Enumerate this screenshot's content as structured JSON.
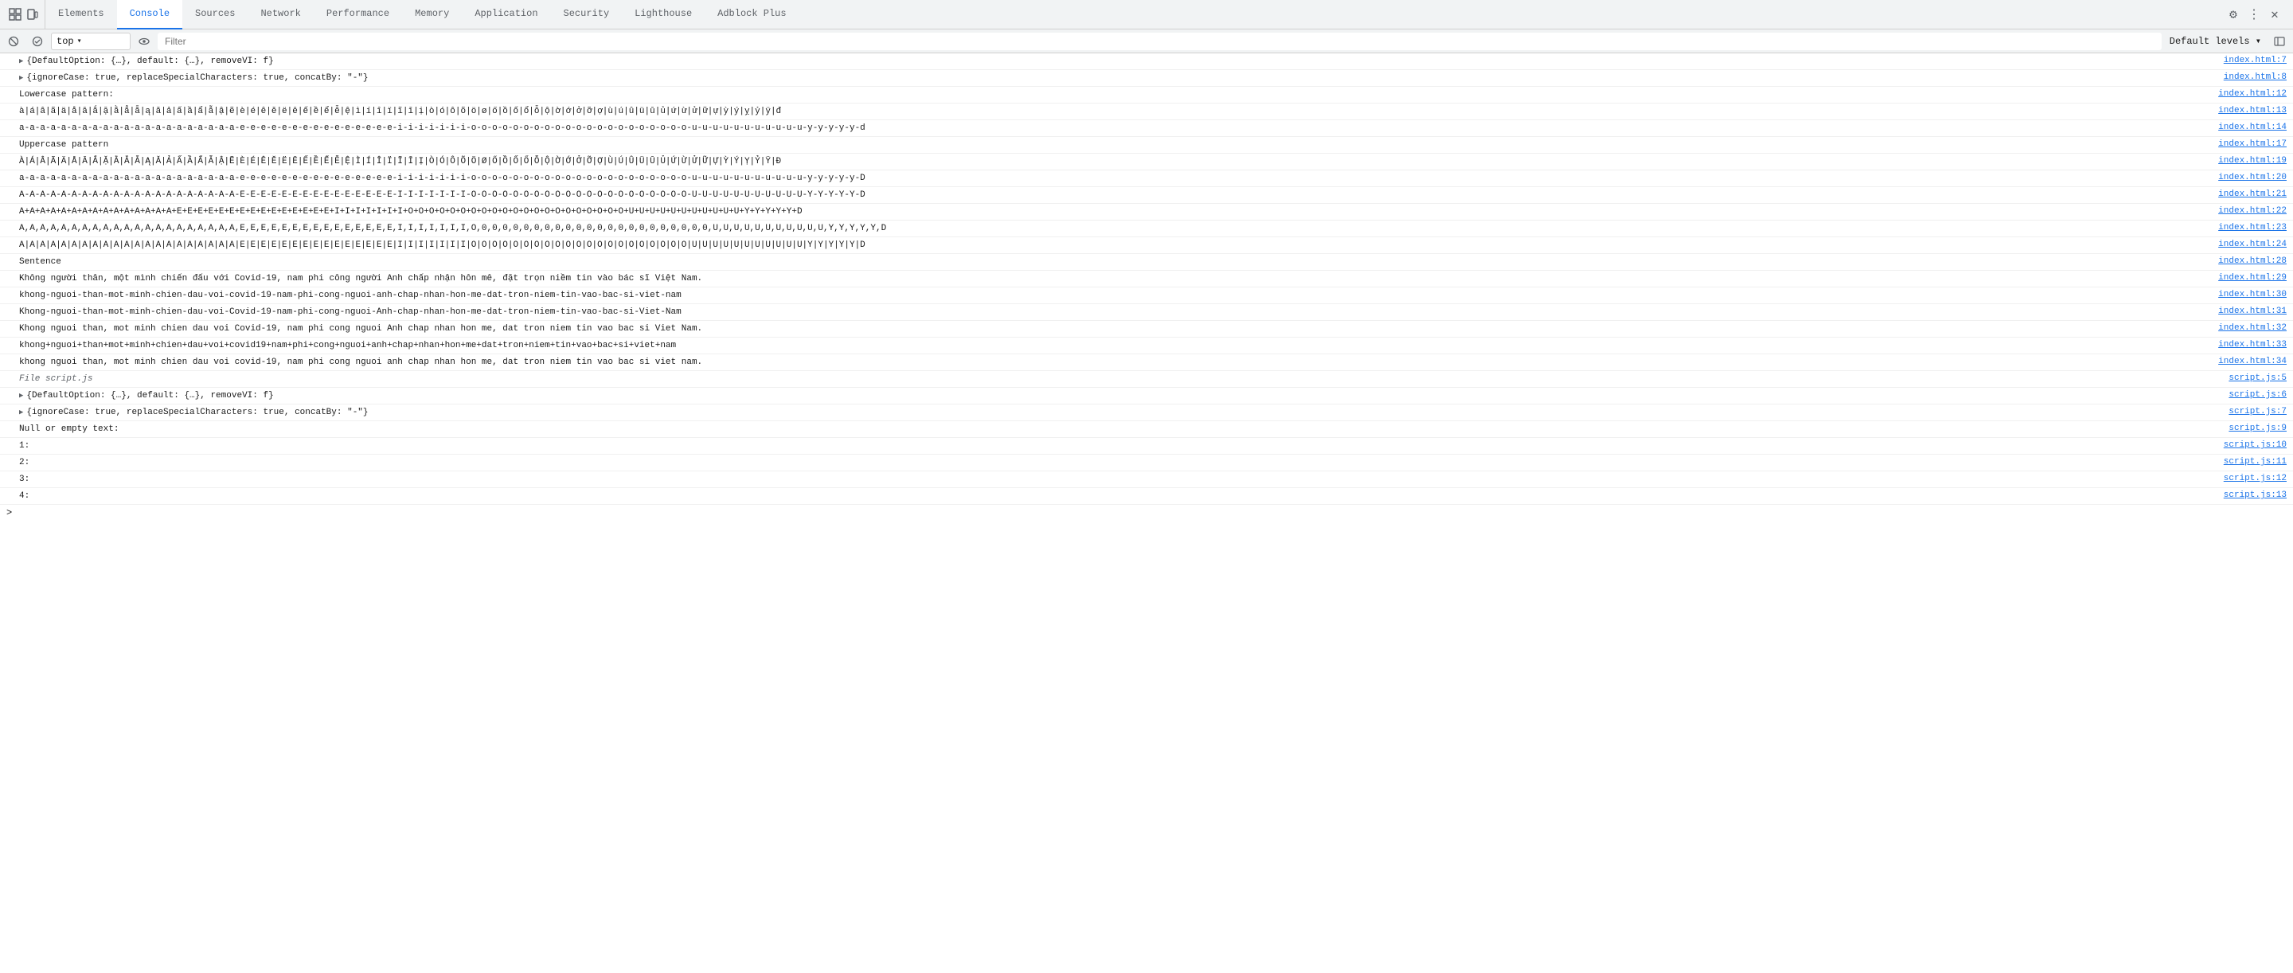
{
  "tabs": [
    {
      "id": "elements",
      "label": "Elements",
      "active": false
    },
    {
      "id": "console",
      "label": "Console",
      "active": true
    },
    {
      "id": "sources",
      "label": "Sources",
      "active": false
    },
    {
      "id": "network",
      "label": "Network",
      "active": false
    },
    {
      "id": "performance",
      "label": "Performance",
      "active": false
    },
    {
      "id": "memory",
      "label": "Memory",
      "active": false
    },
    {
      "id": "application",
      "label": "Application",
      "active": false
    },
    {
      "id": "security",
      "label": "Security",
      "active": false
    },
    {
      "id": "lighthouse",
      "label": "Lighthouse",
      "active": false
    },
    {
      "id": "adblock",
      "label": "Adblock Plus",
      "active": false
    }
  ],
  "toolbar": {
    "context_label": "top",
    "filter_placeholder": "Filter",
    "levels_label": "Default levels ▾"
  },
  "console_lines": [
    {
      "id": 1,
      "type": "expandable",
      "content": "{DefaultOption: {…}, default: {…}, removeVI: f}",
      "source": "index.html:7"
    },
    {
      "id": 2,
      "type": "expandable",
      "content": "{ignoreCase: true, replaceSpecialCharacters: true, concatBy: \"-\"}",
      "source": "index.html:8"
    },
    {
      "id": 3,
      "type": "label",
      "content": "Lowercase pattern:",
      "source": "index.html:12"
    },
    {
      "id": 4,
      "type": "text",
      "content": "à|á|â|ã|ä|å|ā|ắ|ặ|ằ|ẳ|ẵ|ą|ǎ|ả|ấ|ầ|ẩ|ẫ|ậ|ẽ|è|é|ê|ě|ë|ē|ế|ề|ể|ễ|ệ|ì|í|î|ï|ĩ|ī|ị|ò|ó|ô|õ|ö|ø|ő|ồ|ố|ổ|ỗ|ộ|ờ|ớ|ở|ỡ|ợ|ù|ú|û|ü|ū|ủ|ứ|ừ|ử|ữ|ự|ỳ|ý|ỵ|ỷ|ÿ|đ",
      "source": "index.html:13"
    },
    {
      "id": 5,
      "type": "text",
      "content": "a-a-a-a-a-a-a-a-a-a-a-a-a-a-a-a-a-a-a-a-a-e-e-e-e-e-e-e-e-e-e-e-e-e-e-e-i-i-i-i-i-i-i-o-o-o-o-o-o-o-o-o-o-o-o-o-o-o-o-o-o-o-o-o-u-u-u-u-u-u-u-u-u-u-u-y-y-y-y-y-d",
      "source": "index.html:14"
    },
    {
      "id": 6,
      "type": "label",
      "content": "Uppercase pattern",
      "source": "index.html:17"
    },
    {
      "id": 7,
      "type": "text",
      "content": "À|Á|Â|Ã|Ä|Å|Ā|Ắ|Ặ|Ằ|Ẳ|Ẵ|Ą|Ǎ|Ả|Ấ|Ầ|Ẩ|Ẫ|Ậ|Ẽ|È|É|Ê|Ě|Ë|Ē|Ế|Ề|Ể|Ễ|Ệ|Ì|Í|Î|Ï|Ĩ|Ī|Ị|Ò|Ó|Ô|Õ|Ö|Ø|Ő|Ồ|Ố|Ổ|Ỗ|Ộ|Ờ|Ớ|Ở|Ỡ|Ợ|Ù|Ú|Û|Ü|Ū|Ủ|Ứ|Ừ|Ử|Ữ|Ự|Ỳ|Ý|Ỵ|Ỷ|Ÿ|Đ",
      "source": "index.html:19"
    },
    {
      "id": 8,
      "type": "text",
      "content": "a-a-a-a-a-a-a-a-a-a-a-a-a-a-a-a-a-a-a-a-a-e-e-e-e-e-e-e-e-e-e-e-e-e-e-e-i-i-i-i-i-i-i-o-o-o-o-o-o-o-o-o-o-o-o-o-o-o-o-o-o-o-o-o-u-u-u-u-u-u-u-u-u-u-u-y-y-y-y-y-D",
      "source": "index.html:20"
    },
    {
      "id": 9,
      "type": "text",
      "content": "A-A-A-A-A-A-A-A-A-A-A-A-A-A-A-A-A-A-A-A-A-E-E-E-E-E-E-E-E-E-E-E-E-E-E-E-I-I-I-I-I-I-I-O-O-O-O-O-O-O-O-O-O-O-O-O-O-O-O-O-O-O-O-O-U-U-U-U-U-U-U-U-U-U-U-Y-Y-Y-Y-Y-D",
      "source": "index.html:21"
    },
    {
      "id": 10,
      "type": "text",
      "content": "A+A+A+A+A+A+A+A+A+A+A+A+A+A+A+E+E+E+E+E+E+E+E+E+E+E+E+E+E+E+I+I+I+I+I+I+I+O+O+O+O+O+O+O+O+O+O+O+O+O+O+O+O+O+O+O+O+O+U+U+U+U+U+U+U+U+U+U+U+Y+Y+Y+Y+Y+D",
      "source": "index.html:22"
    },
    {
      "id": 11,
      "type": "text",
      "content": "A,A,A,A,A,A,A,A,A,A,A,A,A,A,A,A,A,A,A,A,A,E,E,E,E,E,E,E,E,E,E,E,E,E,E,E,I,I,I,I,I,I,I,O,0,0,0,0,0,0,0,0,0,0,0,0,0,0,0,0,0,0,0,0,0,0,U,U,U,U,U,U,U,U,U,U,U,Y,Y,Y,Y,Y,D",
      "source": "index.html:23"
    },
    {
      "id": 12,
      "type": "text",
      "content": "A|A|A|A|A|A|A|A|A|A|A|A|A|A|A|A|A|A|A|A|A|E|E|E|E|E|E|E|E|E|E|E|E|E|E|E|I|I|I|I|I|I|I|O|O|O|O|O|O|O|O|O|O|O|O|O|O|O|O|O|O|O|O|O|U|U|U|U|U|U|U|U|U|U|U|Y|Y|Y|Y|Y|D",
      "source": "index.html:24"
    },
    {
      "id": 13,
      "type": "label",
      "content": "Sentence",
      "source": "index.html:28"
    },
    {
      "id": 14,
      "type": "text",
      "content": "Không người thân, một mình chiến đấu với Covid-19, nam phi công người Anh chấp nhận hôn mê, đặt trọn niềm tin vào bác sĩ Việt Nam.",
      "source": "index.html:29"
    },
    {
      "id": 15,
      "type": "text",
      "content": "khong-nguoi-than-mot-minh-chien-dau-voi-covid-19-nam-phi-cong-nguoi-anh-chap-nhan-hon-me-dat-tron-niem-tin-vao-bac-si-viet-nam",
      "source": "index.html:30"
    },
    {
      "id": 16,
      "type": "text",
      "content": "Khong-nguoi-than-mot-minh-chien-dau-voi-Covid-19-nam-phi-cong-nguoi-Anh-chap-nhan-hon-me-dat-tron-niem-tin-vao-bac-si-Viet-Nam",
      "source": "index.html:31"
    },
    {
      "id": 17,
      "type": "text",
      "content": "Khong nguoi than, mot minh chien dau voi Covid-19, nam phi cong nguoi Anh chap nhan hon me, dat tron niem tin vao bac si Viet Nam.",
      "source": "index.html:32"
    },
    {
      "id": 18,
      "type": "text",
      "content": "khong+nguoi+than+mot+minh+chien+dau+voi+covid19+nam+phi+cong+nguoi+anh+chap+nhan+hon+me+dat+tron+niem+tin+vao+bac+si+viet+nam",
      "source": "index.html:33"
    },
    {
      "id": 19,
      "type": "text",
      "content": "khong nguoi than, mot minh chien dau voi covid-19, nam phi cong nguoi anh chap nhan hon me, dat tron niem tin vao bac si viet nam.",
      "source": "index.html:34"
    },
    {
      "id": 20,
      "type": "file-label",
      "content": "File script.js",
      "source": "script.js:5"
    },
    {
      "id": 21,
      "type": "expandable",
      "content": "{DefaultOption: {…}, default: {…}, removeVI: f}",
      "source": "script.js:6"
    },
    {
      "id": 22,
      "type": "expandable",
      "content": "{ignoreCase: true, replaceSpecialCharacters: true, concatBy: \"-\"}",
      "source": "script.js:7"
    },
    {
      "id": 23,
      "type": "label",
      "content": "Null or empty text:",
      "source": "script.js:9"
    },
    {
      "id": 24,
      "type": "text",
      "content": "1:",
      "source": "script.js:10"
    },
    {
      "id": 25,
      "type": "text",
      "content": "2:",
      "source": "script.js:11"
    },
    {
      "id": 26,
      "type": "text",
      "content": "3:",
      "source": "script.js:12"
    },
    {
      "id": 27,
      "type": "text",
      "content": "4:",
      "source": "script.js:13"
    }
  ]
}
